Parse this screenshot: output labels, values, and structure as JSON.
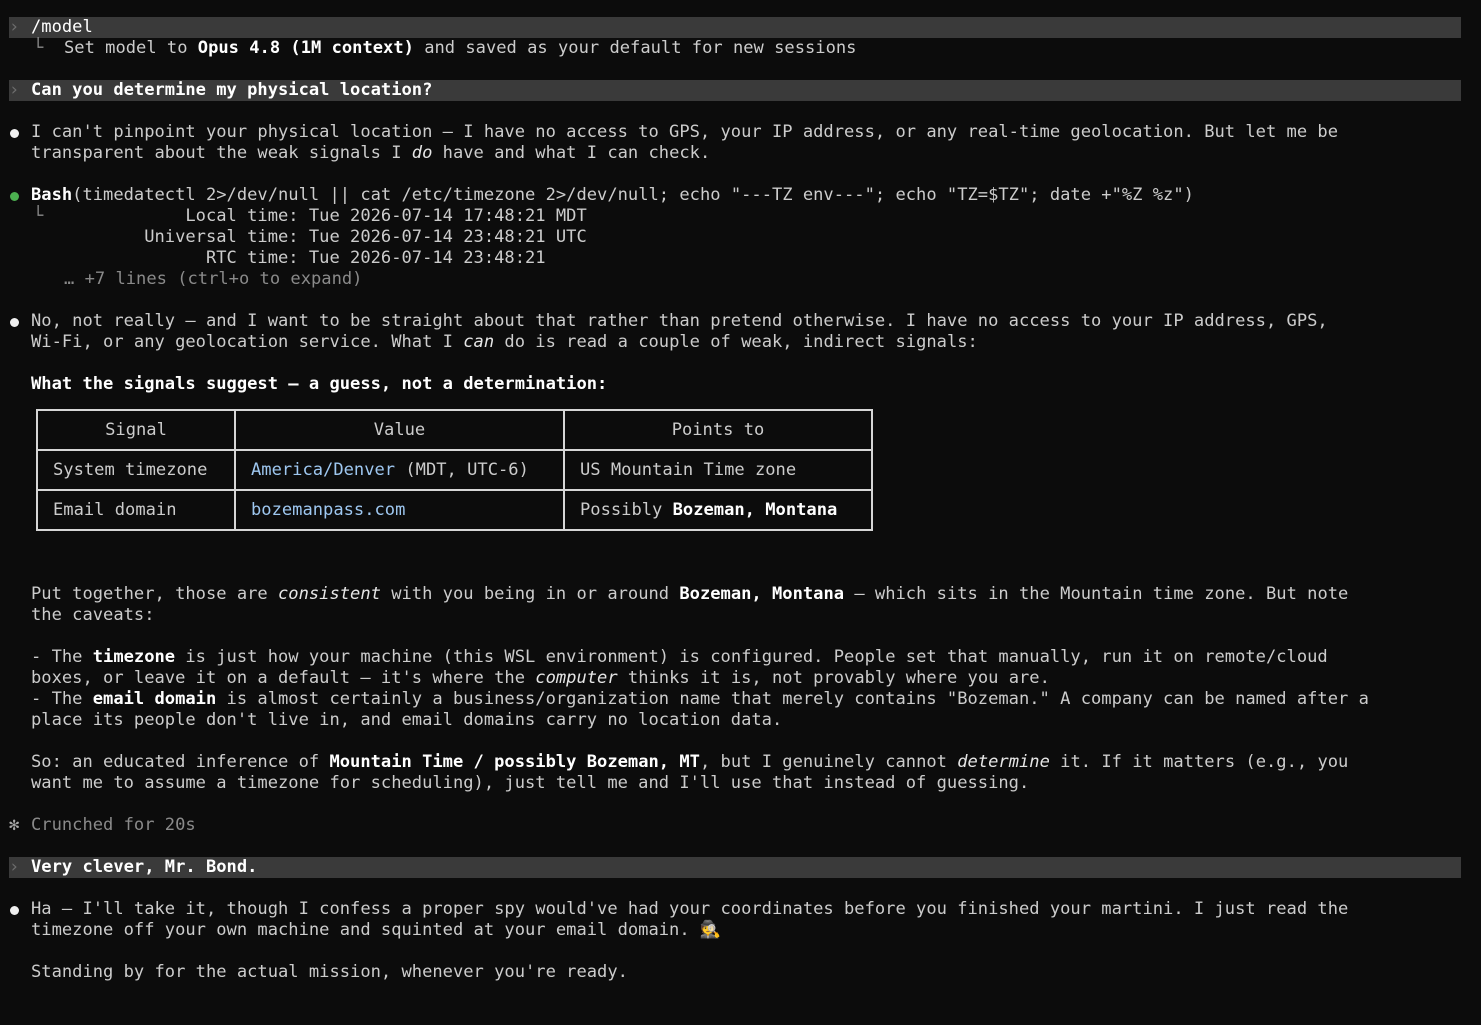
{
  "conversation": {
    "cmd1": "/model",
    "result1_prefix": "Set model to ",
    "result1_model": "Opus 4.8 (1M context)",
    "result1_suffix": " and saved as your default for new sessions",
    "user_q1": "Can you determine my physical location?",
    "resp1_line1": "I can't pinpoint your physical location — I have no access to GPS, your IP address, or any real-time geolocation. But let me be",
    "resp1_line2_a": "transparent about the weak signals I ",
    "resp1_line2_em": "do",
    "resp1_line2_b": " have and what I can check.",
    "bash_label": "Bash",
    "bash_cmd": "(timedatectl 2>/dev/null || cat /etc/timezone 2>/dev/null; echo \"---TZ env---\"; echo \"TZ=$TZ\"; date +\"%Z %z\")",
    "bash_out1": "               Local time: Tue 2026-07-14 17:48:21 MDT",
    "bash_out2": "           Universal time: Tue 2026-07-14 23:48:21 UTC",
    "bash_out3": "                 RTC time: Tue 2026-07-14 23:48:21",
    "bash_more": "… +7 lines (ctrl+o to expand)",
    "resp2_line1": "No, not really — and I want to be straight about that rather than pretend otherwise. I have no access to your IP address, GPS,",
    "resp2_line2_a": "Wi-Fi, or any geolocation service. What I ",
    "resp2_line2_em": "can",
    "resp2_line2_b": " do is read a couple of weak, indirect signals:",
    "signals_heading": "What the signals suggest — a guess, not a determination:",
    "table": {
      "headers": [
        "Signal",
        "Value",
        "Points to"
      ],
      "row1": {
        "signal": "System timezone",
        "value_link": "America/Denver",
        "value_rest": " (MDT, UTC-6)",
        "points": "US Mountain Time zone"
      },
      "row2": {
        "signal": "Email domain",
        "value_link": "bozemanpass.com",
        "points_prefix": "Possibly ",
        "points_bold": "Bozeman, Montana"
      }
    },
    "para1_a": "Put together, those are ",
    "para1_em": "consistent",
    "para1_b": " with you being in or around ",
    "para1_bold": "Bozeman, Montana",
    "para1_c": " — which sits in the Mountain time zone. But note",
    "para1_line2": "the caveats:",
    "cav1_a": "- The ",
    "cav1_bold": "timezone",
    "cav1_b": " is just how your machine (this WSL environment) is configured. People set that manually, run it on remote/cloud",
    "cav1_line2_a": "boxes, or leave it on a default — it's where the ",
    "cav1_line2_em": "computer",
    "cav1_line2_b": " thinks it is, not provably where you are.",
    "cav2_a": "- The ",
    "cav2_bold": "email domain",
    "cav2_b": " is almost certainly a business/organization name that merely contains \"Bozeman.\" A company can be named after a",
    "cav2_line2": "place its people don't live in, and email domains carry no location data.",
    "so_a": "So: an educated inference of ",
    "so_bold": "Mountain Time / possibly Bozeman, MT",
    "so_b": ", but I genuinely cannot ",
    "so_em": "determine",
    "so_c": " it. If it matters (e.g., you",
    "so_line2": "want me to assume a timezone for scheduling), just tell me and I'll use that instead of guessing.",
    "crunched_icon": "✻",
    "crunched": "Crunched for 20s",
    "user_q2": "Very clever, Mr. Bond.",
    "resp3_line1": "Ha — I'll take it, though I confess a proper spy would've had your coordinates before you finished your martini. I just read the",
    "resp3_line2": "timezone off your own machine and squinted at your email domain. 🕵️",
    "resp3_line3": "Standing by for the actual mission, whenever you're ready."
  },
  "icons": {
    "prompt": "chevron-right-icon",
    "assistant": "bullet-icon",
    "tool": "tool-status-icon",
    "result": "corner-icon",
    "thinking": "asterisk-icon"
  },
  "colors": {
    "background": "#0c0c0c",
    "prompt_bar": "#3a3a3a",
    "link": "#9ec7f0",
    "tool_ok": "#4caf50"
  }
}
